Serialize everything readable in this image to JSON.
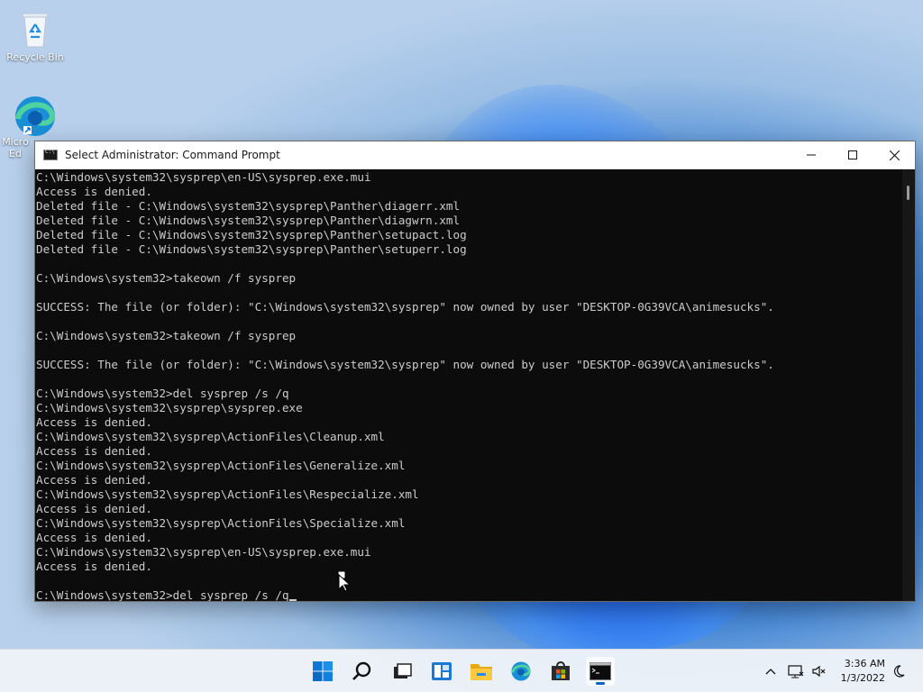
{
  "desktop": {
    "icons": [
      {
        "label": "Recycle Bin"
      },
      {
        "label": "Micro\nEd"
      }
    ]
  },
  "window": {
    "title": "Select Administrator: Command Prompt",
    "controls": {
      "minimize": "—",
      "maximize": "☐",
      "close": "✕"
    },
    "console_lines": [
      "C:\\Windows\\system32\\sysprep\\en-US\\sysprep.exe.mui",
      "Access is denied.",
      "Deleted file - C:\\Windows\\system32\\sysprep\\Panther\\diagerr.xml",
      "Deleted file - C:\\Windows\\system32\\sysprep\\Panther\\diagwrn.xml",
      "Deleted file - C:\\Windows\\system32\\sysprep\\Panther\\setupact.log",
      "Deleted file - C:\\Windows\\system32\\sysprep\\Panther\\setuperr.log",
      "",
      "C:\\Windows\\system32>takeown /f sysprep",
      "",
      "SUCCESS: The file (or folder): \"C:\\Windows\\system32\\sysprep\" now owned by user \"DESKTOP-0G39VCA\\animesucks\".",
      "",
      "C:\\Windows\\system32>takeown /f sysprep",
      "",
      "SUCCESS: The file (or folder): \"C:\\Windows\\system32\\sysprep\" now owned by user \"DESKTOP-0G39VCA\\animesucks\".",
      "",
      "C:\\Windows\\system32>del sysprep /s /q",
      "C:\\Windows\\system32\\sysprep\\sysprep.exe",
      "Access is denied.",
      "C:\\Windows\\system32\\sysprep\\ActionFiles\\Cleanup.xml",
      "Access is denied.",
      "C:\\Windows\\system32\\sysprep\\ActionFiles\\Generalize.xml",
      "Access is denied.",
      "C:\\Windows\\system32\\sysprep\\ActionFiles\\Respecialize.xml",
      "Access is denied.",
      "C:\\Windows\\system32\\sysprep\\ActionFiles\\Specialize.xml",
      "Access is denied.",
      "C:\\Windows\\system32\\sysprep\\en-US\\sysprep.exe.mui",
      "Access is denied.",
      ""
    ],
    "prompt_line": "C:\\Windows\\system32>del sysprep /s /q",
    "colors": {
      "console_bg": "#0c0c0c",
      "console_fg": "#cccccc"
    }
  },
  "taskbar": {
    "icons": [
      "windows-start-icon",
      "search-icon",
      "task-view-icon",
      "widgets-icon",
      "file-explorer-icon",
      "edge-icon",
      "store-icon",
      "command-prompt-icon"
    ],
    "clock": {
      "time": "3:36 AM",
      "date": "1/3/2022"
    },
    "accent": "#0067c0"
  }
}
